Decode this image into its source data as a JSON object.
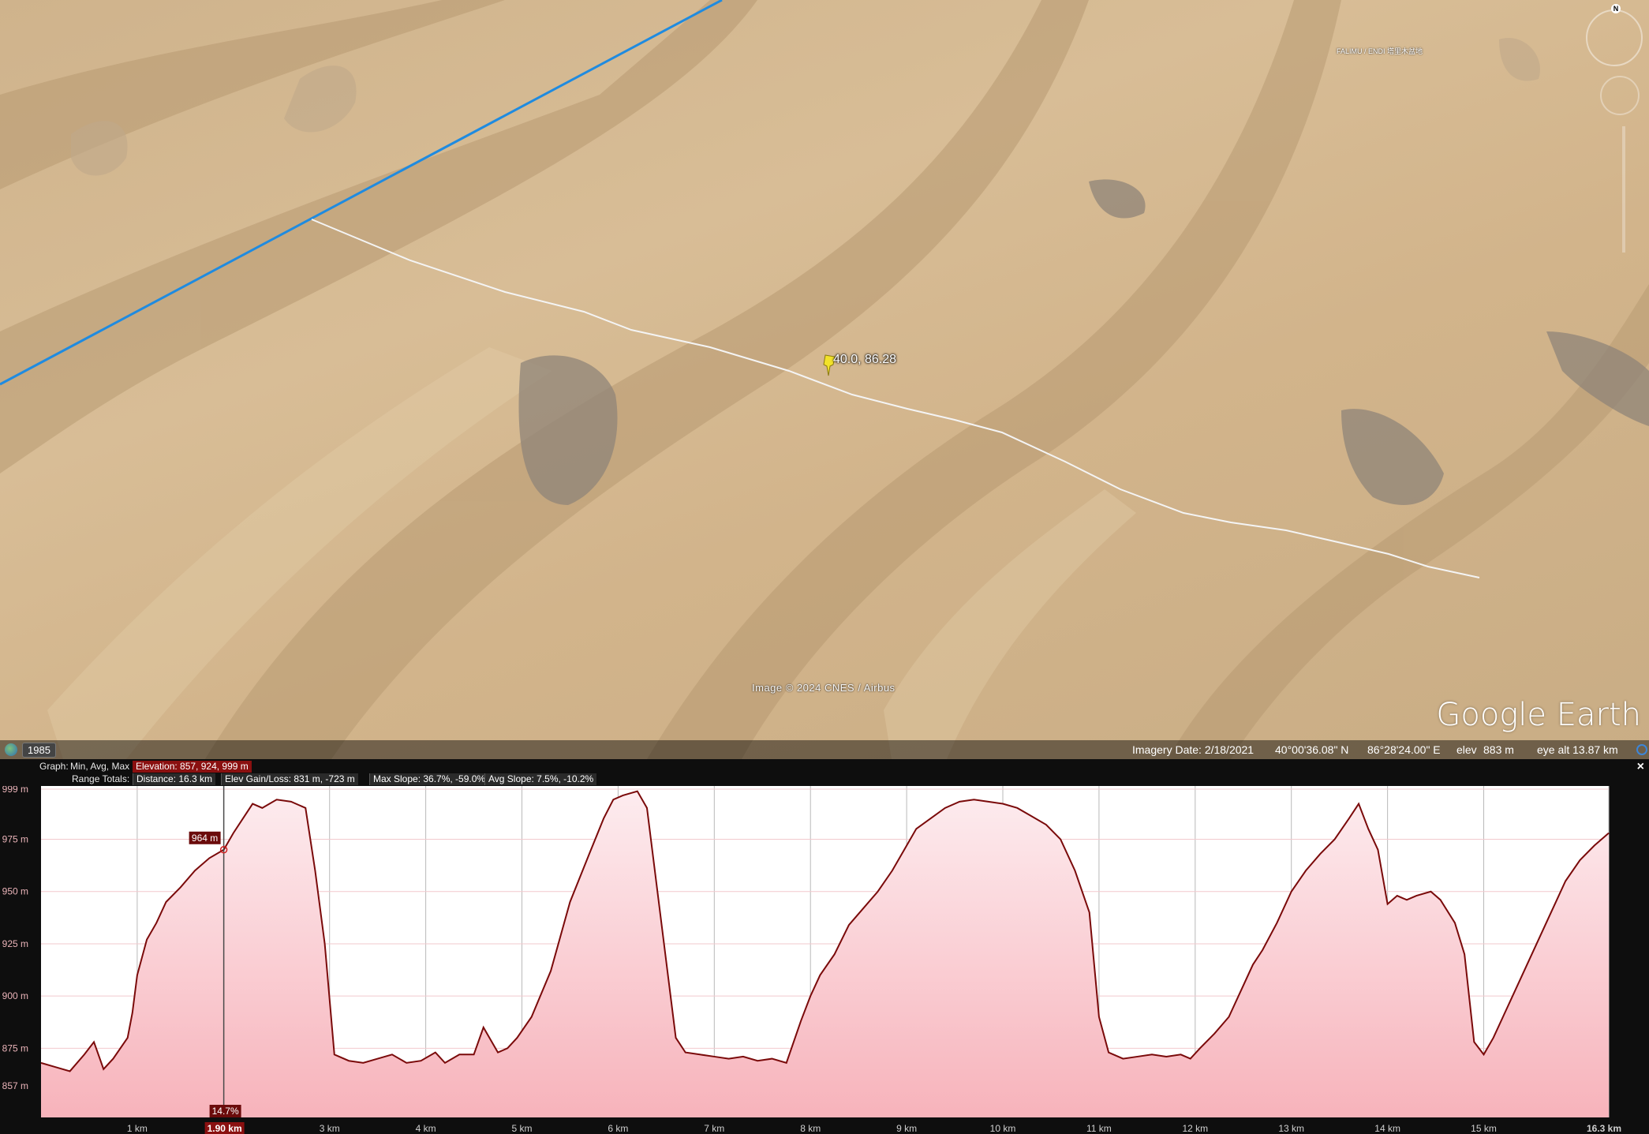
{
  "map": {
    "placemark_label": "40.0, 86.28",
    "copyright": "Image © 2024 CNES / Airbus",
    "place_label": "FALIMU / ENDI 塔里木盆地",
    "logo": "Google Earth",
    "compass_letter": "N",
    "icons": [
      "compass-icon",
      "look-joystick-icon",
      "zoom-slider-icon",
      "placemark-pin-icon",
      "globe-icon",
      "navigation-icon"
    ]
  },
  "statusbar": {
    "historical_year": "1985",
    "imagery_date": "Imagery Date: 2/18/2021",
    "latitude": "40°00'36.08\" N",
    "longitude": "86°28'24.00\" E",
    "elev_label": "elev",
    "elev_value": "883 m",
    "eye_alt": "eye alt  13.87 km"
  },
  "profile": {
    "graph_label": "Graph:",
    "graph_mode": "Min, Avg, Max",
    "elevation_badge": "Elevation: 857, 924, 999 m",
    "range_label": "Range Totals:",
    "distance": "Distance: 16.3 km",
    "elev_gain_loss": "Elev Gain/Loss: 831 m, -723 m",
    "max_slope": "Max Slope: 36.7%, -59.0%",
    "avg_slope": "Avg Slope: 7.5%, -10.2%",
    "close_label": "×",
    "cursor": {
      "distance_km": 1.9,
      "elevation_label": "964 m",
      "slope_label": "14.7%",
      "distance_label": "1.90 km"
    }
  },
  "chart_data": {
    "type": "area",
    "xlabel": "",
    "ylabel": "",
    "xlim": [
      0,
      16.3
    ],
    "ylim": [
      857,
      999
    ],
    "y_ticks": [
      {
        "v": 999,
        "label": "999 m"
      },
      {
        "v": 975,
        "label": "975 m"
      },
      {
        "v": 950,
        "label": "950 m"
      },
      {
        "v": 925,
        "label": "925 m"
      },
      {
        "v": 900,
        "label": "900 m"
      },
      {
        "v": 875,
        "label": "875 m"
      },
      {
        "v": 857,
        "label": "857 m"
      }
    ],
    "x_ticks": [
      {
        "v": 1,
        "label": "1 km"
      },
      {
        "v": 3,
        "label": "3 km"
      },
      {
        "v": 4,
        "label": "4 km"
      },
      {
        "v": 5,
        "label": "5 km"
      },
      {
        "v": 6,
        "label": "6 km"
      },
      {
        "v": 7,
        "label": "7 km"
      },
      {
        "v": 8,
        "label": "8 km"
      },
      {
        "v": 9,
        "label": "9 km"
      },
      {
        "v": 10,
        "label": "10 km"
      },
      {
        "v": 11,
        "label": "11 km"
      },
      {
        "v": 12,
        "label": "12 km"
      },
      {
        "v": 13,
        "label": "13 km"
      },
      {
        "v": 14,
        "label": "14 km"
      },
      {
        "v": 15,
        "label": "15 km"
      },
      {
        "v": 16.3,
        "label": "16.3 km"
      }
    ],
    "grid": true,
    "colors": {
      "line": "#7a0a0a",
      "fill_top": "#fdecef",
      "fill_bottom": "#f7b3bb"
    },
    "x": [
      0,
      0.15,
      0.3,
      0.45,
      0.55,
      0.65,
      0.75,
      0.9,
      0.95,
      1.0,
      1.1,
      1.2,
      1.3,
      1.45,
      1.6,
      1.75,
      1.9,
      2.0,
      2.1,
      2.2,
      2.3,
      2.45,
      2.6,
      2.75,
      2.85,
      2.95,
      3.05,
      3.2,
      3.35,
      3.5,
      3.65,
      3.8,
      3.95,
      4.1,
      4.2,
      4.35,
      4.5,
      4.6,
      4.75,
      4.85,
      4.95,
      5.1,
      5.3,
      5.5,
      5.7,
      5.85,
      5.95,
      6.05,
      6.2,
      6.3,
      6.45,
      6.6,
      6.7,
      6.85,
      7.0,
      7.15,
      7.3,
      7.45,
      7.6,
      7.75,
      7.9,
      8.0,
      8.1,
      8.25,
      8.4,
      8.55,
      8.7,
      8.85,
      9.0,
      9.1,
      9.25,
      9.4,
      9.55,
      9.7,
      9.85,
      10.0,
      10.15,
      10.3,
      10.45,
      10.6,
      10.75,
      10.9,
      11.0,
      11.1,
      11.25,
      11.4,
      11.55,
      11.7,
      11.85,
      11.95,
      12.05,
      12.2,
      12.35,
      12.5,
      12.6,
      12.7,
      12.85,
      13.0,
      13.15,
      13.3,
      13.45,
      13.6,
      13.7,
      13.8,
      13.9,
      14.0,
      14.1,
      14.2,
      14.3,
      14.45,
      14.55,
      14.7,
      14.8,
      14.9,
      15.0,
      15.1,
      15.25,
      15.4,
      15.55,
      15.7,
      15.85,
      16.0,
      16.15,
      16.3
    ],
    "values": [
      868,
      866,
      864,
      872,
      878,
      865,
      870,
      880,
      892,
      910,
      927,
      935,
      945,
      952,
      960,
      966,
      970,
      978,
      985,
      992,
      990,
      994,
      993,
      990,
      960,
      925,
      872,
      869,
      868,
      870,
      872,
      868,
      869,
      873,
      868,
      872,
      872,
      885,
      873,
      875,
      880,
      890,
      912,
      945,
      968,
      985,
      994,
      996,
      998,
      990,
      935,
      880,
      873,
      872,
      871,
      870,
      871,
      869,
      870,
      868,
      888,
      900,
      910,
      920,
      934,
      942,
      950,
      960,
      972,
      980,
      985,
      990,
      993,
      994,
      993,
      992,
      990,
      986,
      982,
      975,
      960,
      940,
      890,
      873,
      870,
      871,
      872,
      871,
      872,
      870,
      875,
      882,
      890,
      905,
      915,
      922,
      935,
      950,
      960,
      968,
      975,
      985,
      992,
      980,
      970,
      944,
      948,
      946,
      948,
      950,
      946,
      935,
      920,
      878,
      872,
      880,
      895,
      910,
      925,
      940,
      955,
      965,
      972,
      978
    ]
  }
}
